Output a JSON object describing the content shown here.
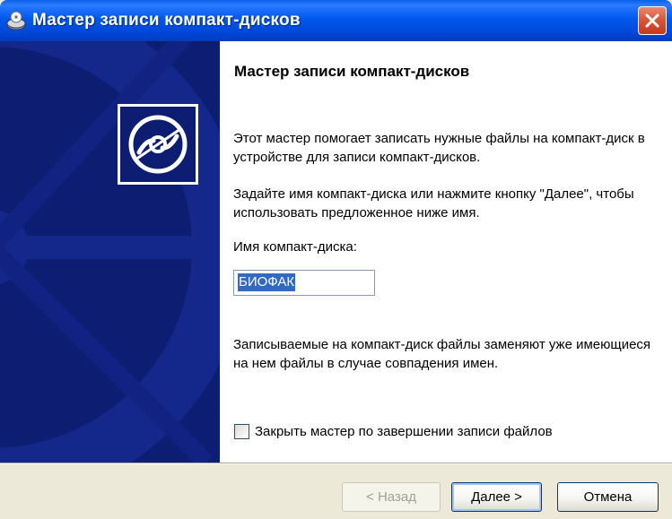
{
  "window": {
    "title": "Мастер записи компакт-дисков",
    "title_bar_color": "#0058ee",
    "close_button_color": "#d9583a"
  },
  "banner": {
    "background_color": "#0d1e72",
    "logo_icon": "cd-disc-icon"
  },
  "content": {
    "heading": "Мастер записи компакт-дисков",
    "paragraph_1": "Этот мастер помогает записать нужные файлы на компакт-диск в устройстве для записи компакт-дисков.",
    "paragraph_2": "Задайте имя компакт-диска или нажмите кнопку \"Далее\", чтобы использовать предложенное ниже имя.",
    "disc_name_label": "Имя компакт-диска:",
    "disc_name_value": "БИОФАК",
    "paragraph_3": "Записываемые на компакт-диск файлы заменяют уже имеющиеся на нем файлы в случае совпадения имен.",
    "close_checkbox_label": "Закрыть мастер по завершении записи файлов",
    "close_checkbox_checked": false
  },
  "buttons": {
    "back_label": "< Назад",
    "back_enabled": false,
    "next_label": "Далее >",
    "cancel_label": "Отмена"
  }
}
